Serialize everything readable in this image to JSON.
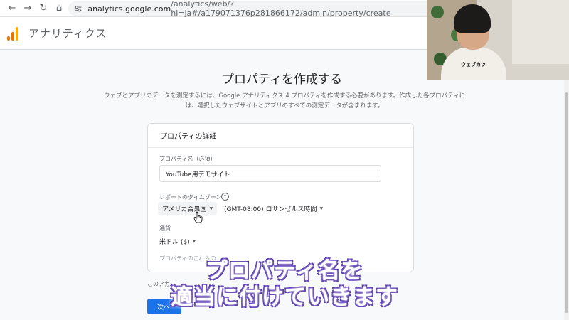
{
  "browser": {
    "url_host": "analytics.google.com",
    "url_path": "/analytics/web/?hl=ja#/a179071376p281866172/admin/property/create"
  },
  "app": {
    "title": "アナリティクス",
    "colors": {
      "logo_1": "#f9ab00",
      "logo_2": "#e37400",
      "logo_3": "#e37400",
      "primary": "#1a73e8"
    }
  },
  "page": {
    "title": "プロパティを作成する",
    "description": "ウェブとアプリのデータを測定するには、Google アナリティクス 4 プロパティを作成する必要があります。作成した各プロパティには、選択したウェブサイトとアプリのすべての測定データが含まれます。"
  },
  "card": {
    "title": "プロパティの詳細",
    "property_name_label": "プロパティ名（必須）",
    "property_name_value": "YouTube用デモサイト",
    "timezone_label": "レポートのタイムゾーン",
    "help_icon": "?",
    "country": "アメリカ合衆国",
    "timezone": "(GMT-08:00) ロサンゼルス時間",
    "currency_label": "通貨",
    "currency": "米ドル ($)",
    "faded_text": "プロパティのこれらの"
  },
  "below_text": "このアカ",
  "next_button": "次へ",
  "webcam": {
    "shirt_text": "ウェブカツ"
  },
  "caption": {
    "line1": "プロパティ名を",
    "line2": "適当に付けていきます"
  }
}
